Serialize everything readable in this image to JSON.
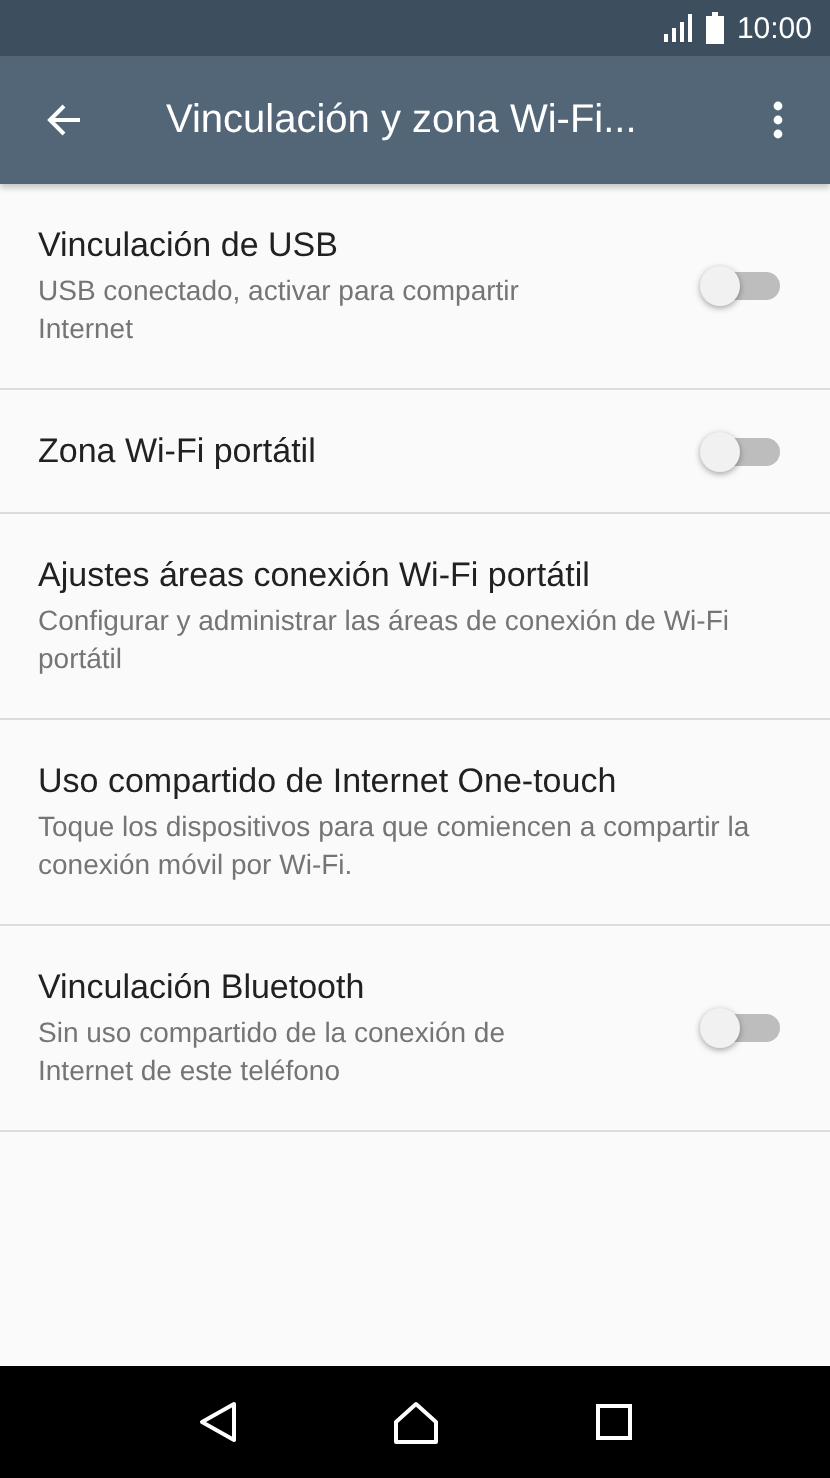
{
  "status_bar": {
    "time": "10:00"
  },
  "app_bar": {
    "title": "Vinculación y zona Wi-Fi..."
  },
  "settings": [
    {
      "kind": "toggle",
      "title": "Vinculación de USB",
      "summary": "USB conectado, activar para compartir Internet",
      "on": false
    },
    {
      "kind": "toggle",
      "title": "Zona Wi-Fi portátil",
      "on": false
    },
    {
      "kind": "plain",
      "title": "Ajustes áreas conexión Wi-Fi portátil",
      "summary": "Configurar y administrar las áreas de conexión de Wi-Fi portátil"
    },
    {
      "kind": "plain",
      "title": "Uso compartido de Internet One-touch",
      "summary": "Toque los dispositivos para que comiencen a compartir la conexión móvil por Wi-Fi."
    },
    {
      "kind": "toggle",
      "title": "Vinculación Bluetooth",
      "summary": "Sin uso compartido de la conexión de Internet de este teléfono",
      "on": false
    }
  ]
}
